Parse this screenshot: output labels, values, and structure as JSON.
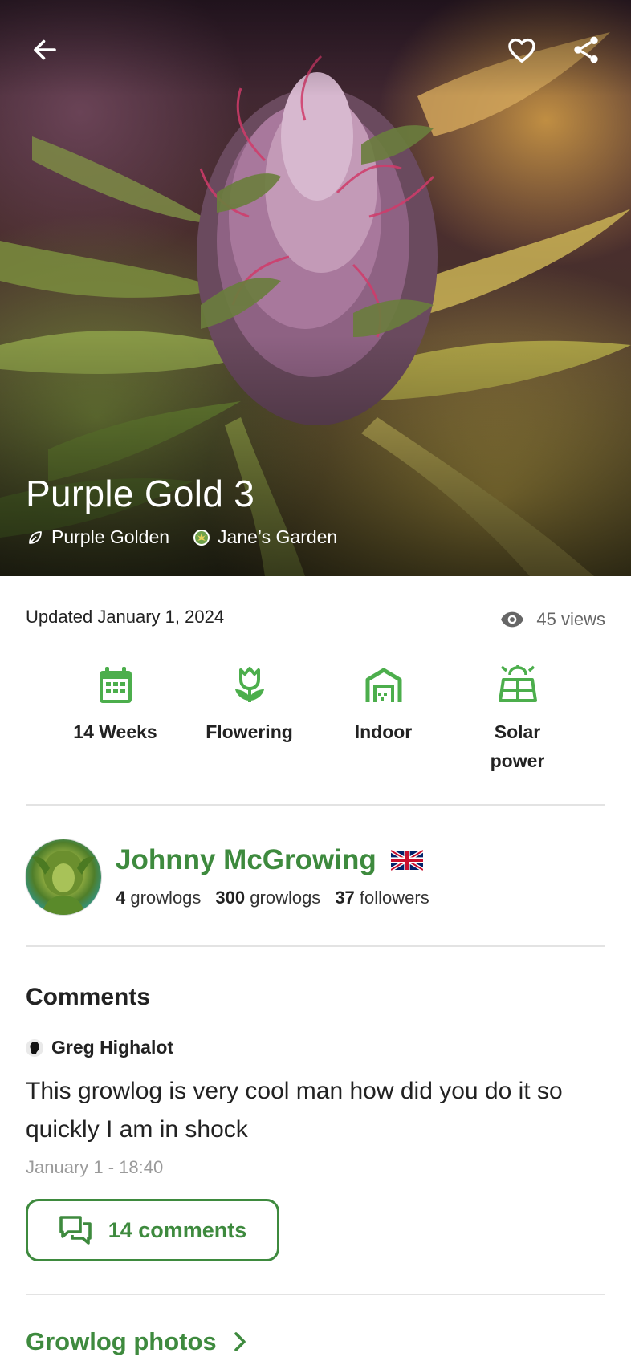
{
  "hero": {
    "title": "Purple Gold 3",
    "strain": "Purple Golden",
    "garden": "Jane’s Garden"
  },
  "info": {
    "updated": "Updated January 1, 2024",
    "views": "45 views"
  },
  "stats": [
    {
      "label": "14 Weeks",
      "icon": "calendar-icon"
    },
    {
      "label": "Flowering",
      "icon": "flower-icon"
    },
    {
      "label": "Indoor",
      "icon": "greenhouse-icon"
    },
    {
      "label": "Solar power",
      "icon": "solar-panel-icon"
    }
  ],
  "profile": {
    "name": "Johnny McGrowing",
    "flag": "uk-flag-icon",
    "stats": [
      {
        "count": "4",
        "label": "growlogs"
      },
      {
        "count": "300",
        "label": "growlogs"
      },
      {
        "count": "37",
        "label": "followers"
      }
    ]
  },
  "comments": {
    "title": "Comments",
    "author": "Greg Highalot",
    "text": "This growlog is very cool man how did you do it so quickly I am in shock",
    "time": "January 1 - 18:40",
    "button_label": "14 comments"
  },
  "photos": {
    "link_label": "Growlog photos"
  },
  "colors": {
    "accent": "#3e8a3e",
    "icon_green": "#4cae4c",
    "divider": "#e3e3e3"
  }
}
